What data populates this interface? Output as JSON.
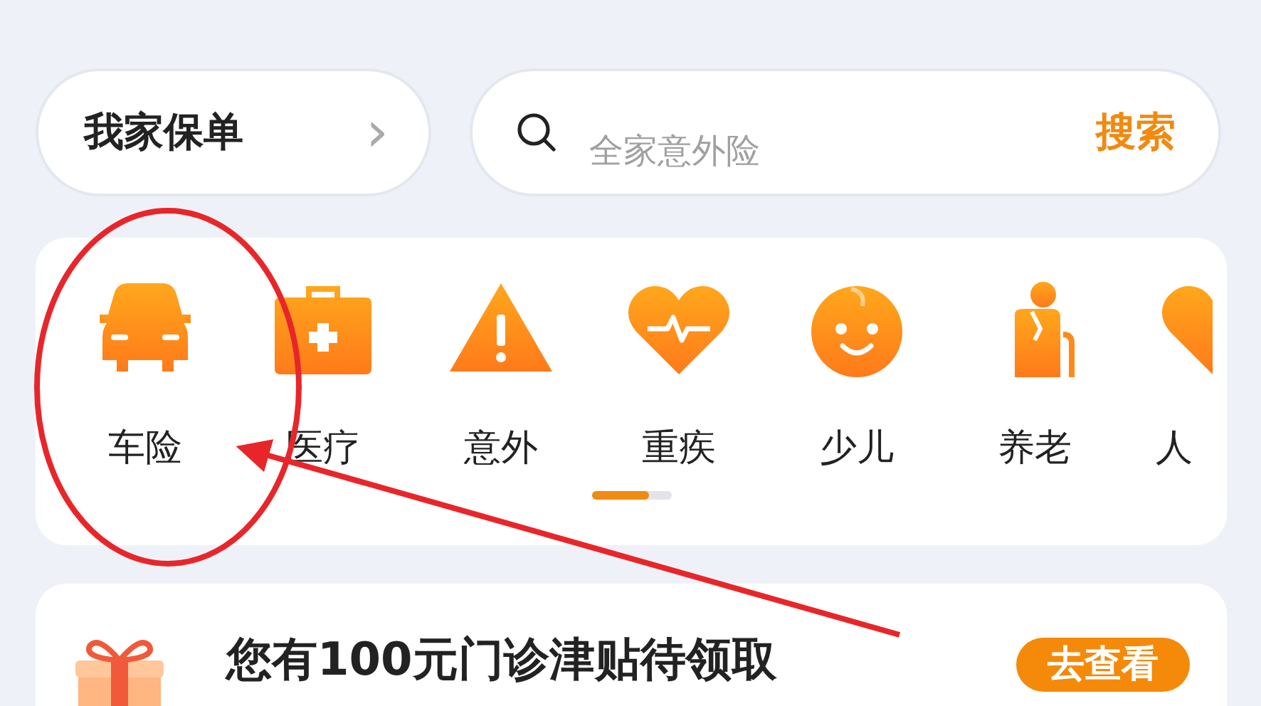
{
  "my_policy": {
    "label": "我家保单",
    "chevron": "›"
  },
  "search": {
    "placeholder": "全家意外险",
    "button": "搜索"
  },
  "categories": [
    {
      "label": "车险",
      "kind": "car"
    },
    {
      "label": "医疗",
      "kind": "medkit"
    },
    {
      "label": "意外",
      "kind": "warning"
    },
    {
      "label": "重疾",
      "kind": "heart"
    },
    {
      "label": "少儿",
      "kind": "baby"
    },
    {
      "label": "养老",
      "kind": "elder"
    },
    {
      "label": "人",
      "kind": "partial"
    }
  ],
  "promo": {
    "title": "您有100元门诊津贴待领取",
    "button": "去查看"
  }
}
